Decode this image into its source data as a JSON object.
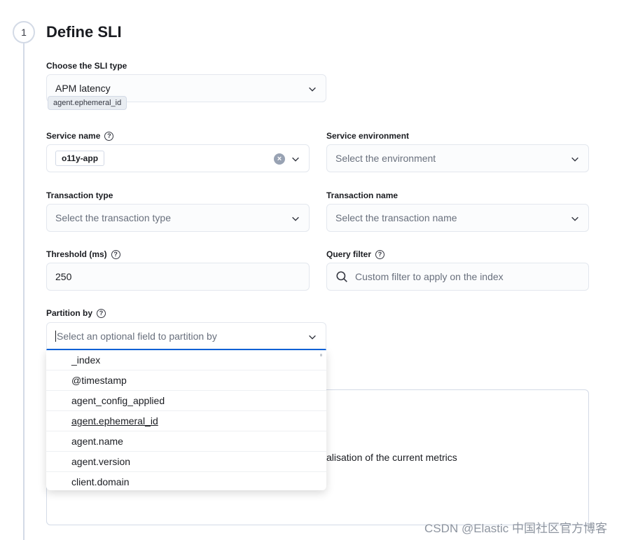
{
  "step": {
    "number": "1",
    "title": "Define SLI"
  },
  "sli_type": {
    "label": "Choose the SLI type",
    "value": "APM latency",
    "tooltip": "agent.ephemeral_id"
  },
  "service_name": {
    "label": "Service name",
    "value": "o11y-app"
  },
  "service_environment": {
    "label": "Service environment",
    "placeholder": "Select the environment"
  },
  "transaction_type": {
    "label": "Transaction type",
    "placeholder": "Select the transaction type"
  },
  "transaction_name": {
    "label": "Transaction name",
    "placeholder": "Select the transaction name"
  },
  "threshold": {
    "label": "Threshold (ms)",
    "value": "250"
  },
  "query_filter": {
    "label": "Query filter",
    "placeholder": "Custom filter to apply on the index"
  },
  "partition_by": {
    "label": "Partition by",
    "placeholder": "Select an optional field to partition by",
    "options": [
      "_index",
      "@timestamp",
      "agent_config_applied",
      "agent.ephemeral_id",
      "agent.name",
      "agent.version",
      "client.domain"
    ]
  },
  "preview": {
    "text": "alisation of the current metrics"
  },
  "watermark": "CSDN @Elastic 中国社区官方博客"
}
